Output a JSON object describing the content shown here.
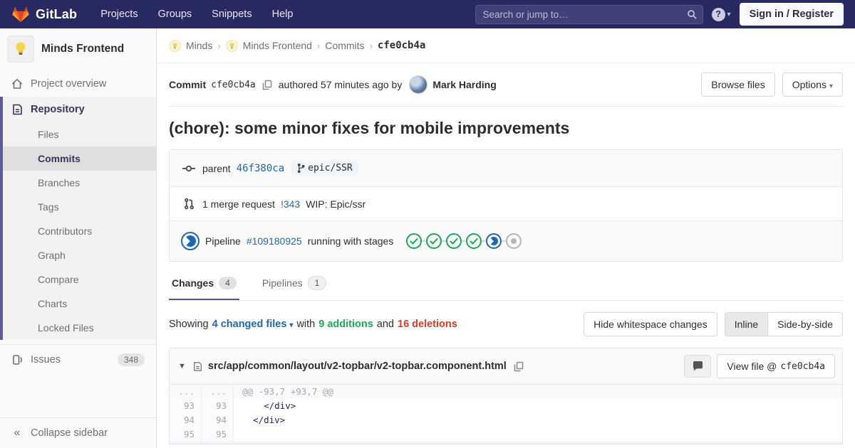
{
  "navbar": {
    "brand": "GitLab",
    "links": [
      "Projects",
      "Groups",
      "Snippets",
      "Help"
    ],
    "search_placeholder": "Search or jump to…",
    "sign_in_label": "Sign in / Register"
  },
  "sidebar": {
    "project_name": "Minds Frontend",
    "overview_label": "Project overview",
    "repository_label": "Repository",
    "repo_items": [
      "Files",
      "Commits",
      "Branches",
      "Tags",
      "Contributors",
      "Graph",
      "Compare",
      "Charts",
      "Locked Files"
    ],
    "issues_label": "Issues",
    "issues_count": "348",
    "collapse_label": "Collapse sidebar"
  },
  "breadcrumb": {
    "group": "Minds",
    "project": "Minds Frontend",
    "section": "Commits",
    "current": "cfe0cb4a"
  },
  "commit": {
    "label": "Commit",
    "sha": "cfe0cb4a",
    "authored_text": "authored 57 minutes ago by",
    "author": "Mark Harding",
    "browse_files_label": "Browse files",
    "options_label": "Options",
    "title": "(chore): some minor fixes for mobile improvements",
    "parent_label": "parent",
    "parent_sha": "46f380ca",
    "branch": "epic/SSR",
    "merge_request_text": "1 merge request",
    "merge_request_ref": "!343",
    "merge_request_title": "WIP: Epic/ssr",
    "pipeline_label": "Pipeline",
    "pipeline_id": "#109180925",
    "pipeline_status_text": "running with stages",
    "stages": [
      "passed",
      "passed",
      "passed",
      "passed",
      "running",
      "created"
    ]
  },
  "tabs": [
    {
      "label": "Changes",
      "count": "4"
    },
    {
      "label": "Pipelines",
      "count": "1"
    }
  ],
  "diff_controls": {
    "showing": "Showing",
    "changed_files": "4 changed files",
    "with_text": "with",
    "additions": "9 additions",
    "and_text": "and",
    "deletions": "16 deletions",
    "hide_whitespace_label": "Hide whitespace changes",
    "inline_label": "Inline",
    "side_by_side_label": "Side-by-side"
  },
  "file_diff": {
    "path": "src/app/common/layout/v2-topbar/v2-topbar.component.html",
    "view_file_label": "View file @",
    "view_file_sha": "cfe0cb4a",
    "lines": [
      {
        "old": "...",
        "new": "...",
        "code": "@@ -93,7 +93,7 @@",
        "type": "match"
      },
      {
        "old": "93",
        "new": "93",
        "code": "    </div>",
        "type": "context"
      },
      {
        "old": "94",
        "new": "94",
        "code": "  </div>",
        "type": "context"
      },
      {
        "old": "95",
        "new": "95",
        "code": "",
        "type": "context"
      }
    ]
  },
  "colors": {
    "navbar_bg": "#292961",
    "link_blue": "#1b69b6",
    "additions_green": "#1aaa55",
    "deletions_red": "#db3b21",
    "active_purple": "#55549c"
  }
}
